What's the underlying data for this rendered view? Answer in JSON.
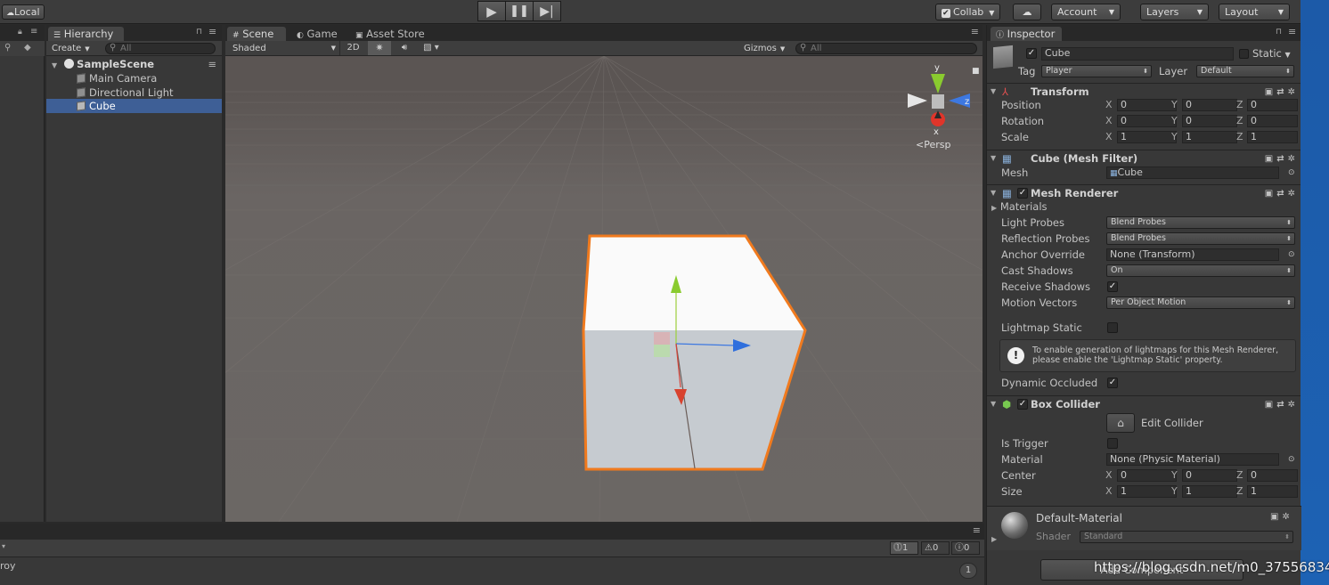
{
  "toolbar": {
    "local_label": "Local",
    "collab_label": "Collab",
    "account_label": "Account",
    "layers_label": "Layers",
    "layout_label": "Layout"
  },
  "hierarchy": {
    "tab_label": "Hierarchy",
    "create_label": "Create",
    "search_placeholder": "All",
    "scene_name": "SampleScene",
    "items": [
      {
        "label": "Main Camera",
        "selected": false
      },
      {
        "label": "Directional Light",
        "selected": false
      },
      {
        "label": "Cube",
        "selected": true
      }
    ]
  },
  "scene": {
    "tabs": [
      "Scene",
      "Game",
      "Asset Store"
    ],
    "shading_mode": "Shaded",
    "mode_2d": "2D",
    "gizmos_label": "Gizmos",
    "search_placeholder": "All",
    "persp_label": "Persp",
    "axis_labels": {
      "y": "y",
      "z": "z",
      "x": "x"
    }
  },
  "inspector": {
    "tab_label": "Inspector",
    "object_name": "Cube",
    "static_label": "Static",
    "tag_label": "Tag",
    "tag_value": "Player",
    "layer_label": "Layer",
    "layer_value": "Default",
    "transform": {
      "title": "Transform",
      "position_label": "Position",
      "position": {
        "x": "0",
        "y": "0",
        "z": "0"
      },
      "rotation_label": "Rotation",
      "rotation": {
        "x": "0",
        "y": "0",
        "z": "0"
      },
      "scale_label": "Scale",
      "scale": {
        "x": "1",
        "y": "1",
        "z": "1"
      }
    },
    "mesh_filter": {
      "title": "Cube (Mesh Filter)",
      "mesh_label": "Mesh",
      "mesh_value": "Cube"
    },
    "mesh_renderer": {
      "title": "Mesh Renderer",
      "materials_label": "Materials",
      "light_probes_label": "Light Probes",
      "light_probes_value": "Blend Probes",
      "reflection_probes_label": "Reflection Probes",
      "reflection_probes_value": "Blend Probes",
      "anchor_override_label": "Anchor Override",
      "anchor_override_value": "None (Transform)",
      "cast_shadows_label": "Cast Shadows",
      "cast_shadows_value": "On",
      "receive_shadows_label": "Receive Shadows",
      "motion_vectors_label": "Motion Vectors",
      "motion_vectors_value": "Per Object Motion",
      "lightmap_static_label": "Lightmap Static",
      "info_line1": "To enable generation of lightmaps for this Mesh Renderer,",
      "info_line2": "please enable the 'Lightmap Static' property.",
      "dynamic_occluded_label": "Dynamic Occluded"
    },
    "box_collider": {
      "title": "Box Collider",
      "edit_collider_label": "Edit Collider",
      "is_trigger_label": "Is Trigger",
      "material_label": "Material",
      "material_value": "None (Physic Material)",
      "center_label": "Center",
      "center": {
        "x": "0",
        "y": "0",
        "z": "0"
      },
      "size_label": "Size",
      "size": {
        "x": "1",
        "y": "1",
        "z": "1"
      }
    },
    "material": {
      "name": "Default-Material",
      "shader_label": "Shader",
      "shader_value": "Standard"
    },
    "add_component_label": "Add Component"
  },
  "console": {
    "error_count": "1",
    "warning_count": "0",
    "info_count": "0",
    "status_text": "roy",
    "badge_count": "1"
  },
  "watermark": "https://blog.csdn.net/m0_37556834",
  "colors": {
    "selection": "#3e5f96",
    "outline": "#f07a1e",
    "panel": "#383838"
  }
}
